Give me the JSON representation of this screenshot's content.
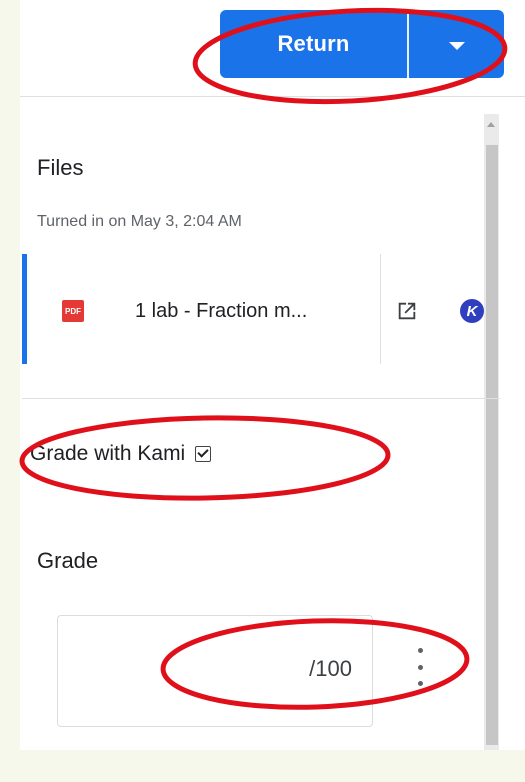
{
  "header": {
    "return_label": "Return",
    "dropdown_icon": "caret-down-icon"
  },
  "files": {
    "heading": "Files",
    "turned_in": "Turned in on May 3, 2:04 AM",
    "items": [
      {
        "type_badge": "PDF",
        "name": "1 lab - Fraction m...",
        "open_icon": "open-in-new-icon",
        "kami_icon": "kami-icon",
        "kami_letter": "K"
      }
    ]
  },
  "kami": {
    "label": "Grade with Kami",
    "checked": true
  },
  "grade": {
    "heading": "Grade",
    "value": "/100",
    "menu_icon": "more-vert-icon"
  },
  "colors": {
    "accent": "#1a73e8",
    "annotation": "#e0101b",
    "pdf": "#e53935",
    "kami": "#2f3fbe"
  }
}
